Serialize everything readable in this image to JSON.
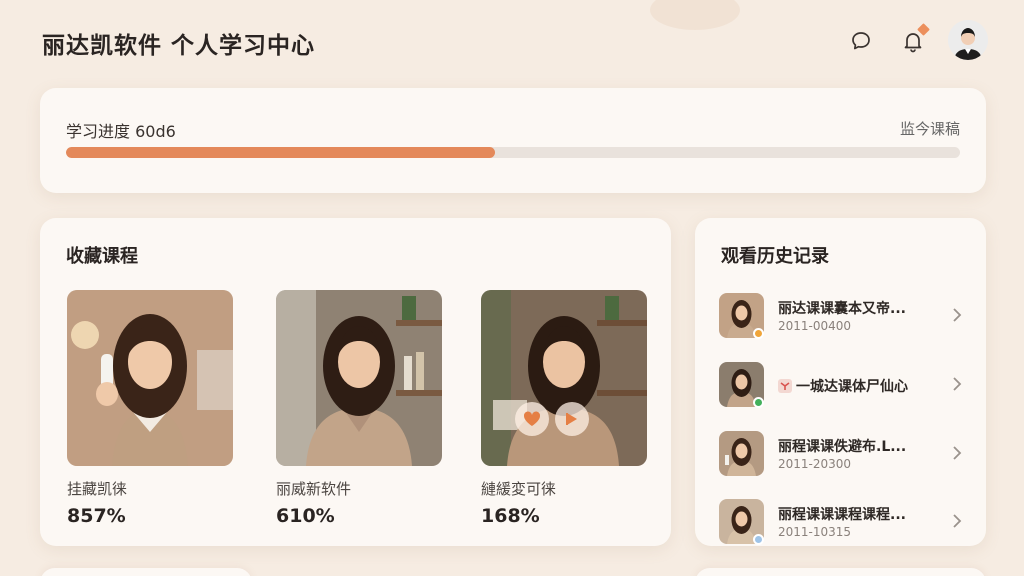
{
  "header": {
    "app_title": "丽达凯软件  个人学习中心",
    "icons": [
      "chat-icon",
      "bell-icon",
      "avatar"
    ],
    "accent_color": "#e4895a"
  },
  "progress": {
    "label": "学习进度 60d6",
    "right_link": "监今课稿",
    "value": 0.48
  },
  "favorites": {
    "title": "收藏课程",
    "courses": [
      {
        "name": "挂藏凯徕",
        "percent": "857%"
      },
      {
        "name": "丽威新软件",
        "percent": "610%"
      },
      {
        "name": "縺緩変可徕",
        "percent": "168%"
      }
    ]
  },
  "history": {
    "title": "观看历史记录",
    "items": [
      {
        "title": "丽达课课囊本又帝...",
        "date": "2011-00400",
        "badge_color": "#f0a53a"
      },
      {
        "title": "一城达课体尸仙心",
        "date": "",
        "badge_color": "#43b05c"
      },
      {
        "title": "丽程课课佚避布.L...",
        "date": "2011-20300",
        "badge_color": ""
      },
      {
        "title": "丽程课课课程课程...",
        "date": "2011-10315",
        "badge_color": "#9fc4e8"
      }
    ]
  }
}
